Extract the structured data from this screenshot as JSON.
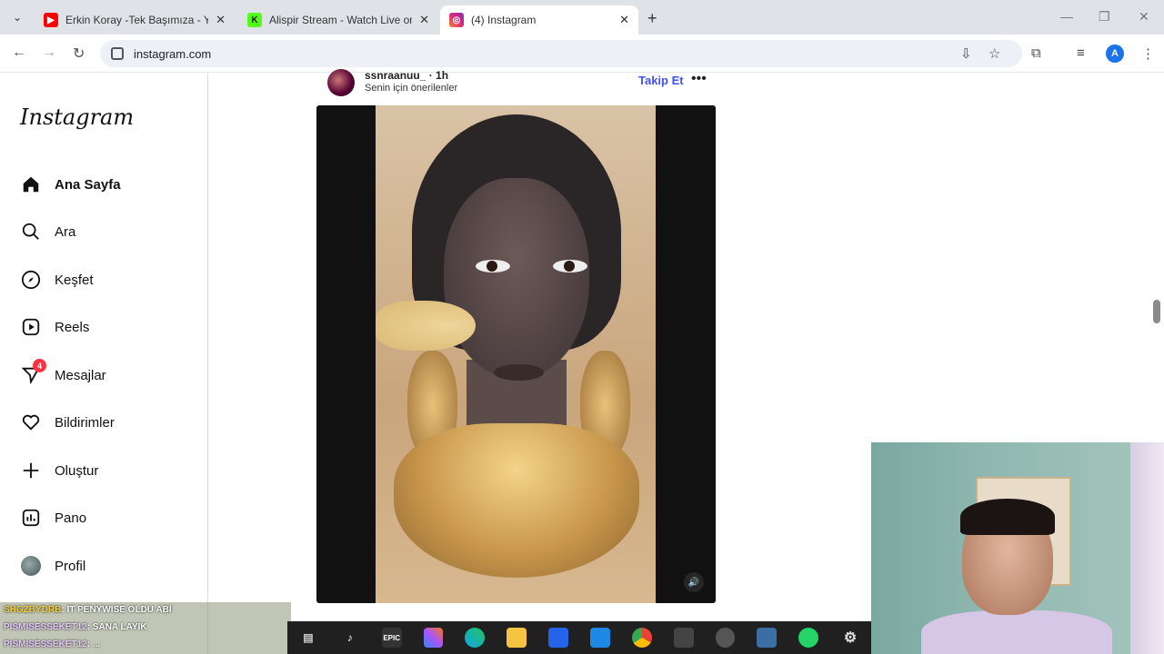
{
  "browser": {
    "tabs": [
      {
        "title": "Erkin Koray -Tek Başımıza - You",
        "favicon": "youtube-icon",
        "color": "#ff0000"
      },
      {
        "title": "Alispir Stream - Watch Live on K",
        "favicon": "kick-icon",
        "color": "#53fc18"
      },
      {
        "title": "(4) Instagram",
        "favicon": "instagram-icon",
        "color": "#e1306c"
      }
    ],
    "url": "instagram.com"
  },
  "sidebar": {
    "logo": "Instagram",
    "items": [
      {
        "label": "Ana Sayfa",
        "icon": "home-icon"
      },
      {
        "label": "Ara",
        "icon": "search-icon"
      },
      {
        "label": "Keşfet",
        "icon": "compass-icon"
      },
      {
        "label": "Reels",
        "icon": "reels-icon"
      },
      {
        "label": "Mesajlar",
        "icon": "messenger-icon",
        "badge": "4"
      },
      {
        "label": "Bildirimler",
        "icon": "heart-icon"
      },
      {
        "label": "Oluştur",
        "icon": "plus-icon"
      },
      {
        "label": "Pano",
        "icon": "dashboard-icon"
      },
      {
        "label": "Profil",
        "icon": "profile-avatar"
      }
    ]
  },
  "post": {
    "username": "ssnraanuu_ · 1h",
    "subtitle": "Senin için önerilenler",
    "follow_label": "Takip Et",
    "more_label": "•••"
  },
  "chat": {
    "lines": [
      {
        "user": "SHGZBYDRB",
        "text": ": IT PENYWISE OLDU ABİ"
      },
      {
        "user": "PISMISESSEKET12",
        "text": ": SANA LAYIK"
      },
      {
        "user": "PISMISESSEKET12",
        "text": ": ..."
      }
    ]
  },
  "colors": {
    "accent": "#4150f7",
    "badge": "#ff3040"
  }
}
